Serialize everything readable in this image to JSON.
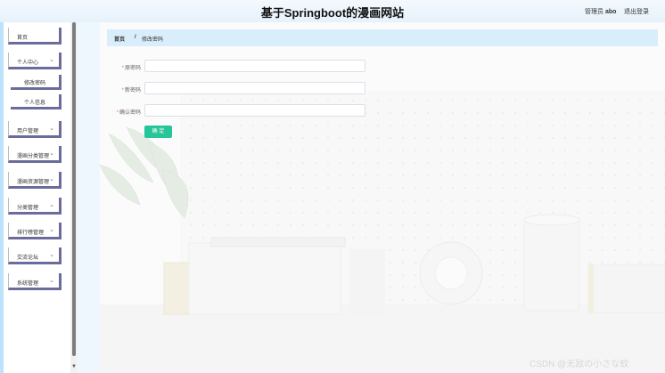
{
  "header": {
    "title": "基于Springboot的漫画网站",
    "user_role": "管理员",
    "user_name": "abo",
    "logout": "退出登录"
  },
  "sidebar": {
    "items": [
      {
        "label": "首页",
        "has_chevron": false
      },
      {
        "label": "个人中心",
        "has_chevron": true
      },
      {
        "label": "修改密码",
        "sub": true
      },
      {
        "label": "个人信息",
        "sub": true
      },
      {
        "label": "用户管理",
        "has_chevron": true
      },
      {
        "label": "漫画分类管理",
        "has_chevron": true
      },
      {
        "label": "漫画资源管理",
        "has_chevron": true
      },
      {
        "label": "分类管理",
        "has_chevron": true
      },
      {
        "label": "排行榜管理",
        "has_chevron": true
      },
      {
        "label": "交流论坛",
        "has_chevron": true
      },
      {
        "label": "系统管理",
        "has_chevron": true
      }
    ],
    "scroll_down_icon": "triangle-down-icon"
  },
  "breadcrumb": {
    "home": "首页",
    "separator": "/",
    "current": "修改密码"
  },
  "form": {
    "old_password": {
      "label": "原密码",
      "required": "*",
      "value": ""
    },
    "new_password": {
      "label": "新密码",
      "required": "*",
      "value": ""
    },
    "confirm_password": {
      "label": "确认密码",
      "required": "*",
      "value": ""
    },
    "submit": "确 定"
  },
  "colors": {
    "accent": "#26c59a",
    "breadcrumb_bg": "#d8eefa",
    "sidebar_border": "#6c6c9c",
    "required": "#f56c6c"
  },
  "watermark": "CSDN @无敌の小さな蚊"
}
